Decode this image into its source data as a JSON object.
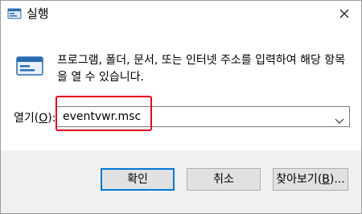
{
  "window": {
    "title": "실행",
    "title_icon": "run-icon",
    "close_icon": "close-icon"
  },
  "description": "프로그램, 폴더, 문서, 또는 인터넷 주소를 입력하여 해당 항목을 열 수 있습니다.",
  "open_field": {
    "label_prefix": "열기(",
    "label_access_key": "O",
    "label_suffix": "):",
    "value": "eventvwr.msc",
    "dropdown_icon": "chevron-down-icon"
  },
  "buttons": {
    "ok": "확인",
    "cancel": "취소",
    "browse_prefix": "찾아보기(",
    "browse_access_key": "B",
    "browse_suffix": ")..."
  },
  "colors": {
    "highlight": "#e3001b",
    "default_button_border": "#0078d7",
    "footer_bg": "#f0f0f0"
  }
}
